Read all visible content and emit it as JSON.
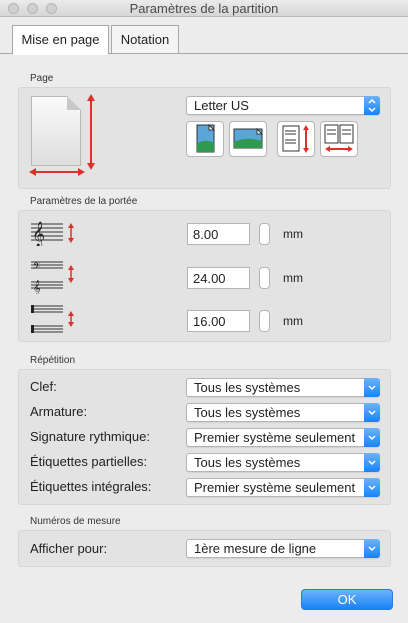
{
  "window": {
    "title": "Paramètres de la partition"
  },
  "tabs": [
    {
      "label": "Mise en page",
      "active": true
    },
    {
      "label": "Notation",
      "active": false
    }
  ],
  "page": {
    "section_label": "Page",
    "paper_size": "Letter US",
    "icons": [
      "portrait-orientation-icon",
      "landscape-orientation-icon",
      "vertical-spacing-icon",
      "horizontal-spacing-icon"
    ]
  },
  "staff": {
    "section_label": "Paramètres de la portée",
    "rows": [
      {
        "icon": "treble-staff-size-icon",
        "value": "8.00",
        "unit": "mm"
      },
      {
        "icon": "system-spacing-icon",
        "value": "24.00",
        "unit": "mm"
      },
      {
        "icon": "staff-spacing-icon",
        "value": "16.00",
        "unit": "mm"
      }
    ]
  },
  "repetition": {
    "section_label": "Répétition",
    "rows": [
      {
        "label": "Clef:",
        "value": "Tous les systèmes"
      },
      {
        "label": "Armature:",
        "value": "Tous les systèmes"
      },
      {
        "label": "Signature rythmique:",
        "value": "Premier système seulement"
      },
      {
        "label": "Étiquettes partielles:",
        "value": "Tous les systèmes"
      },
      {
        "label": "Étiquettes intégrales:",
        "value": "Premier système seulement"
      }
    ]
  },
  "measure_numbers": {
    "section_label": "Numéros de mesure",
    "label": "Afficher pour:",
    "value": "1ère mesure de ligne"
  },
  "ok_label": "OK",
  "colors": {
    "accent": "#1a82f7",
    "red_arrow": "#e0302b",
    "green": "#2f9a4e"
  }
}
